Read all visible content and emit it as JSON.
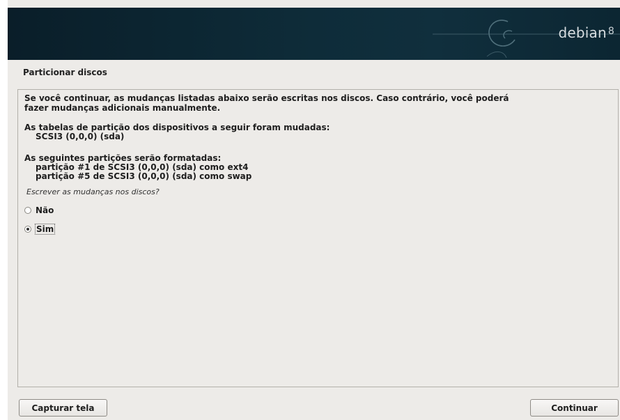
{
  "banner": {
    "brand": "debian",
    "version": "8"
  },
  "page_title": "Particionar discos",
  "body": {
    "intro_line1": "Se você continuar, as mudanças listadas abaixo serão escritas nos discos. Caso contrário, você poderá",
    "intro_line2": "fazer mudanças adicionais manualmente.",
    "tables_heading": "As tabelas de partição dos dispositivos a seguir foram mudadas:",
    "tables_device": "SCSI3 (0,0,0) (sda)",
    "format_heading": "As seguintes partições serão formatadas:",
    "format_items": [
      "partição #1 de SCSI3 (0,0,0) (sda) como ext4",
      "partição #5 de SCSI3 (0,0,0) (sda) como swap"
    ],
    "question": "Escrever as mudanças nos discos?"
  },
  "options": [
    {
      "label": "Não",
      "selected": false
    },
    {
      "label": "Sim",
      "selected": true
    }
  ],
  "buttons": {
    "screenshot": "Capturar tela",
    "continue": "Continuar"
  }
}
